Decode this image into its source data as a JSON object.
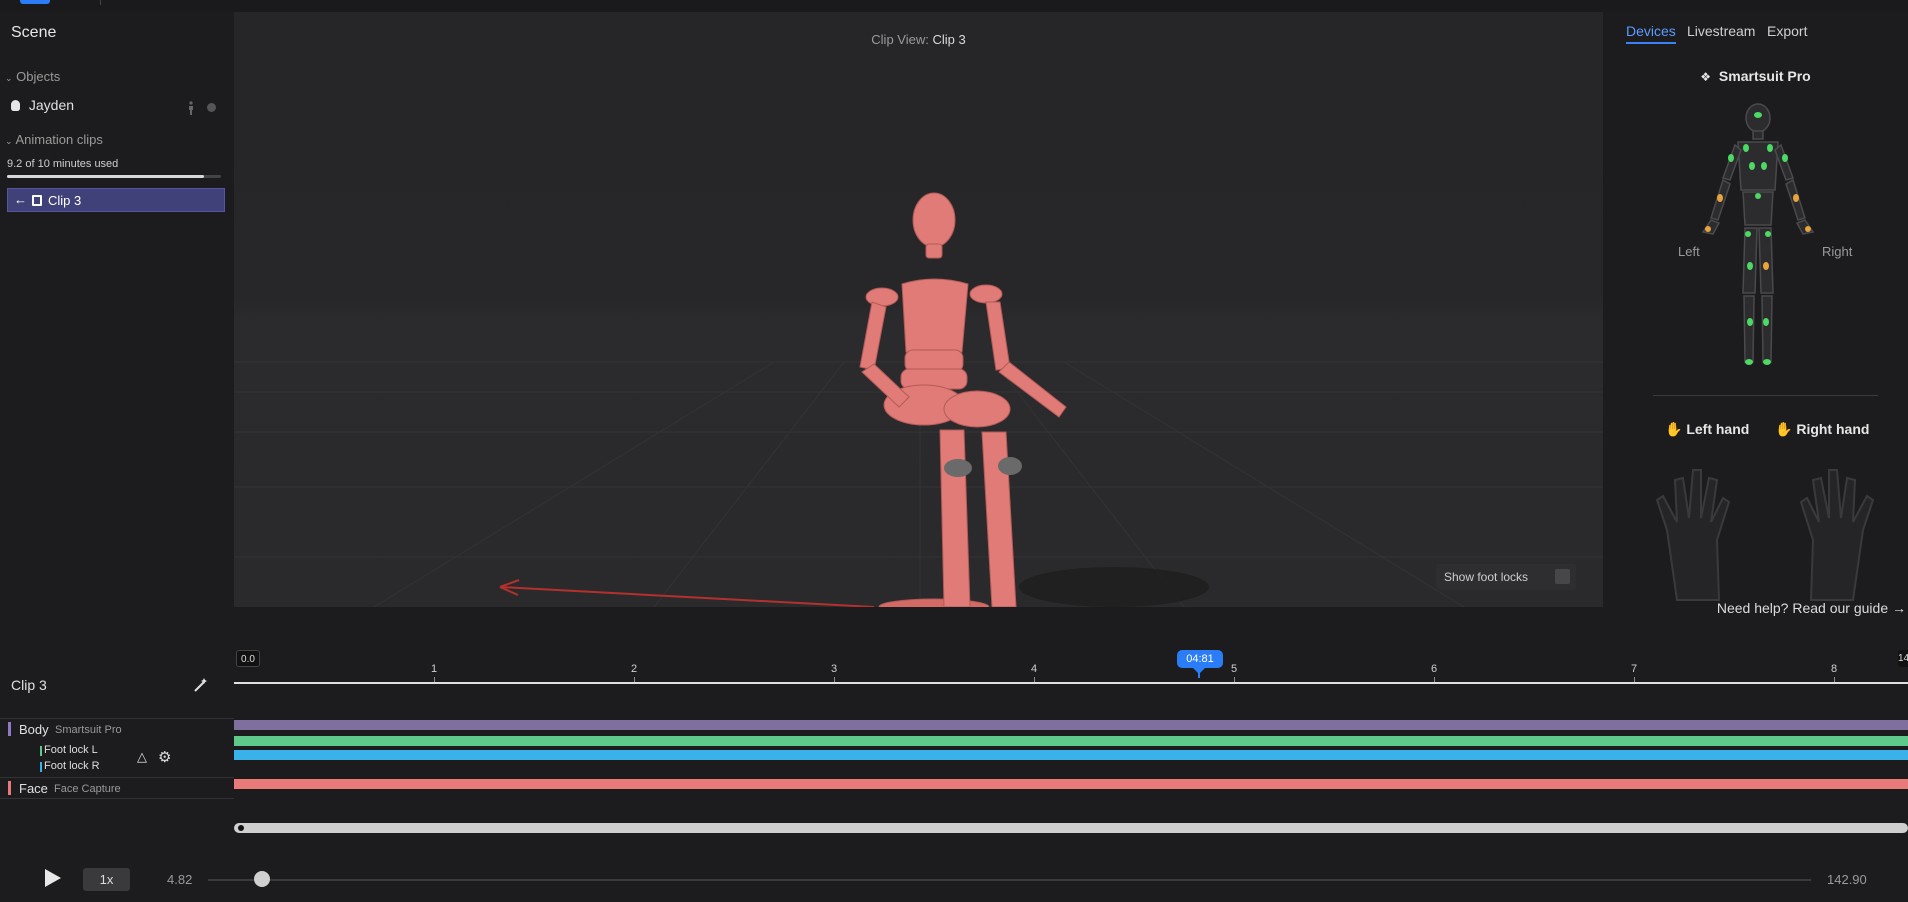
{
  "left_panel": {
    "title": "Scene",
    "objects_header": "Objects",
    "objects": [
      {
        "name": "Jayden"
      }
    ],
    "clips_header": "Animation clips",
    "usage_text": "9.2 of 10 minutes used",
    "usage_fraction": 0.92,
    "clips": [
      {
        "label": "Clip 3",
        "selected": true
      }
    ]
  },
  "viewport": {
    "clip_view_prefix": "Clip View:",
    "clip_view_name": "Clip 3",
    "show_foot_locks_label": "Show foot locks",
    "show_foot_locks_checked": false
  },
  "right_panel": {
    "tabs": [
      "Devices",
      "Livestream",
      "Export"
    ],
    "active_tab": "Devices",
    "suit_title": "Smartsuit Pro",
    "left_label": "Left",
    "right_label": "Right",
    "left_hand_label": "Left hand",
    "right_hand_label": "Right hand",
    "help_text": "Need help? Read our guide →"
  },
  "timeline": {
    "clip_name": "Clip 3",
    "start_label": "0.0",
    "playhead_label": "04:81",
    "end_label": "14",
    "ticks": [
      "1",
      "2",
      "3",
      "4",
      "5",
      "6",
      "7",
      "8"
    ],
    "tracks": [
      {
        "name": "Body",
        "device": "Smartsuit Pro",
        "color": "#7f6f9f"
      },
      {
        "name": "Foot lock L",
        "color": "#5ec98a"
      },
      {
        "name": "Foot lock R",
        "color": "#38b2e8"
      },
      {
        "name": "Face",
        "device": "Face Capture",
        "color": "#ea7a7a"
      }
    ]
  },
  "transport": {
    "speed": "1x",
    "current_time": "4.82",
    "end_time": "142.90",
    "progress_fraction": 0.0337
  },
  "colors": {
    "accent": "#2a7cf7",
    "selected_clip": "#41417a",
    "sensor_ok": "#4cd964",
    "sensor_warn": "#e8a33c"
  }
}
